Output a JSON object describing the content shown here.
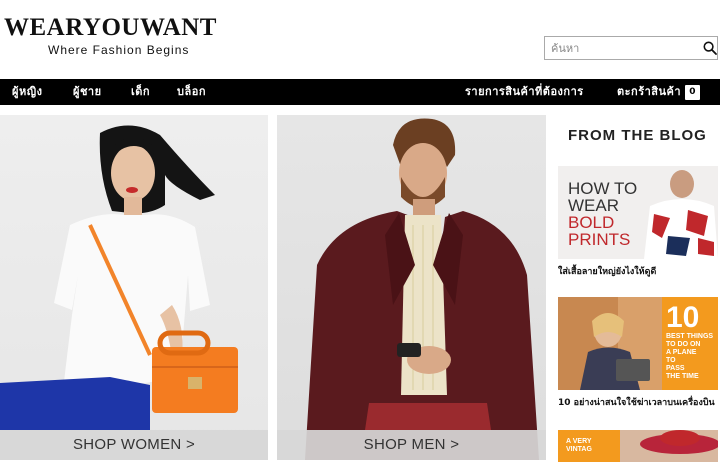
{
  "brand": {
    "name": "WearYouWant",
    "tagline": "Where Fashion Begins"
  },
  "search": {
    "placeholder": "ค้นหา",
    "icon": "search-icon"
  },
  "nav": {
    "items": [
      "ผู้หญิง",
      "ผู้ชาย",
      "เด็ก",
      "บล็อก"
    ],
    "wishlist": "รายการสินค้าที่ต้องการ",
    "cart_label": "ตะกร้าสินค้า",
    "cart_count": "0"
  },
  "hero": {
    "women_label": "SHOP WOMEN >",
    "men_label": "SHOP MEN >"
  },
  "blog": {
    "title": "FROM THE BLOG",
    "posts": [
      {
        "thumb_lines": [
          "HOW TO",
          "WEAR",
          "BOLD",
          "PRINTS"
        ],
        "caption": "ใส่เสื้อลายใหญ่ยังไงให้ดูดี"
      },
      {
        "thumb_number": "10",
        "thumb_lines": [
          "BEST THINGS",
          "TO DO ON",
          "A PLANE",
          "TO",
          "PASS",
          "THE TIME"
        ],
        "caption": "10 อย่างน่าสนใจใช้ฆ่าเวลาบนเครื่องบิน"
      },
      {
        "thumb_lines": [
          "A VERY",
          "VINTAG"
        ]
      }
    ]
  },
  "colors": {
    "nav_bg": "#000000",
    "accent_orange": "#f39a1e",
    "bag_orange": "#f47c20",
    "blog_red": "#c0282c",
    "jacket_burgundy": "#5a1a1e"
  }
}
